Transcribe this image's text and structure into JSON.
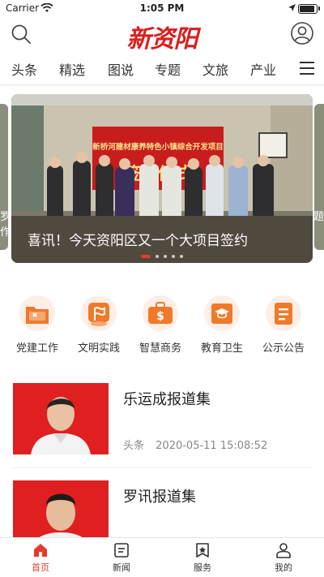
{
  "status_bar": {
    "carrier": "Carrier",
    "time": "1:05 PM"
  },
  "header": {
    "logo": "新资阳"
  },
  "channels": [
    "头条",
    "精选",
    "图说",
    "专题",
    "文旅",
    "产业"
  ],
  "banner": {
    "caption": "喜讯！今天资阳区又一个大项目签约",
    "backdrop_text": "新桥河建材康养特色小镇综合开发项目",
    "sign_text": "签约仪式",
    "left_peek": "罗 作",
    "right_peek": "题",
    "slide_count": 5,
    "active_slide": 1
  },
  "categories": [
    {
      "label": "党建工作",
      "icon": "party-flag-folder-icon"
    },
    {
      "label": "文明实践",
      "icon": "civilization-flag-icon"
    },
    {
      "label": "智慧商务",
      "icon": "briefcase-dollar-icon"
    },
    {
      "label": "教育卫生",
      "icon": "graduation-book-icon"
    },
    {
      "label": "公示公告",
      "icon": "notice-document-icon"
    }
  ],
  "news": [
    {
      "title": "乐运成报道集",
      "source": "头条",
      "time": "2020-05-11 15:08:52"
    },
    {
      "title": "罗讯报道集",
      "source": "",
      "time": ""
    }
  ],
  "bottom_tabs": [
    {
      "label": "首页",
      "icon": "home-icon",
      "active": true
    },
    {
      "label": "新闻",
      "icon": "news-icon",
      "active": false
    },
    {
      "label": "服务",
      "icon": "service-bookmark-icon",
      "active": false
    },
    {
      "label": "我的",
      "icon": "profile-icon",
      "active": false
    }
  ],
  "colors": {
    "accent": "#e53a2d",
    "logo": "#d91f1f",
    "category_icon": "#f07a2a",
    "thumb_bg": "#e02020"
  }
}
